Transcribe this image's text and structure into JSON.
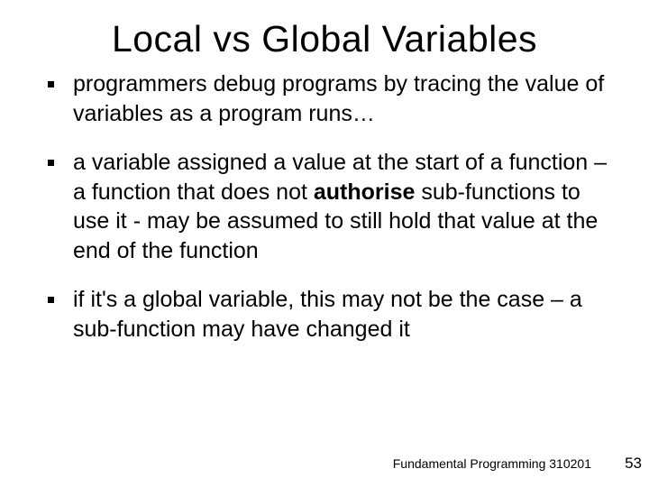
{
  "title": "Local vs Global Variables",
  "bullets": [
    {
      "pre": "programmers debug programs by tracing the value of variables as a program runs…",
      "bold": "",
      "post": ""
    },
    {
      "pre": "a variable assigned a value at the start of a function – a function that does not ",
      "bold": "authorise",
      "post": " sub-functions to use it - may be assumed to still hold that value at the end of the function"
    },
    {
      "pre": "if it's a global variable, this may not be the case – a sub-function may have changed it",
      "bold": "",
      "post": ""
    }
  ],
  "footer": "Fundamental Programming 310201",
  "page_number": "53"
}
